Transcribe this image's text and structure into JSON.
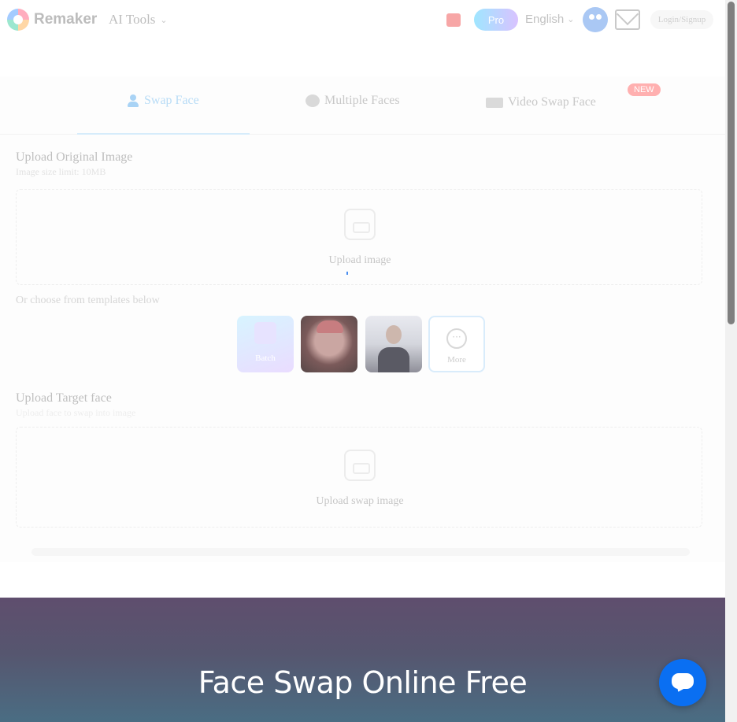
{
  "header": {
    "logo_text": "Remaker",
    "ai_tools_label": "AI Tools",
    "pro_label": "Pro",
    "language": "English",
    "login_label": "Login/Signup"
  },
  "tabs": [
    {
      "label": "Swap Face",
      "active": true
    },
    {
      "label": "Multiple Faces",
      "active": false
    },
    {
      "label": "Video Swap Face",
      "active": false,
      "badge": "NEW"
    }
  ],
  "original": {
    "title": "Upload Original Image",
    "subtitle": "Image size limit: 10MB",
    "upload_label": "Upload image",
    "choose_text": "Or choose from templates below"
  },
  "templates": {
    "batch_label": "Batch",
    "more_label": "More"
  },
  "target": {
    "title": "Upload Target face",
    "subtitle": "Upload face to swap into image",
    "upload_label": "Upload swap image"
  },
  "hero": {
    "title": "Face Swap Online Free"
  },
  "colors": {
    "accent": "#0a6ff2",
    "hero_top": "#5f4e6e",
    "hero_bottom": "#4a6d83",
    "new_badge": "#ffb0b0"
  }
}
